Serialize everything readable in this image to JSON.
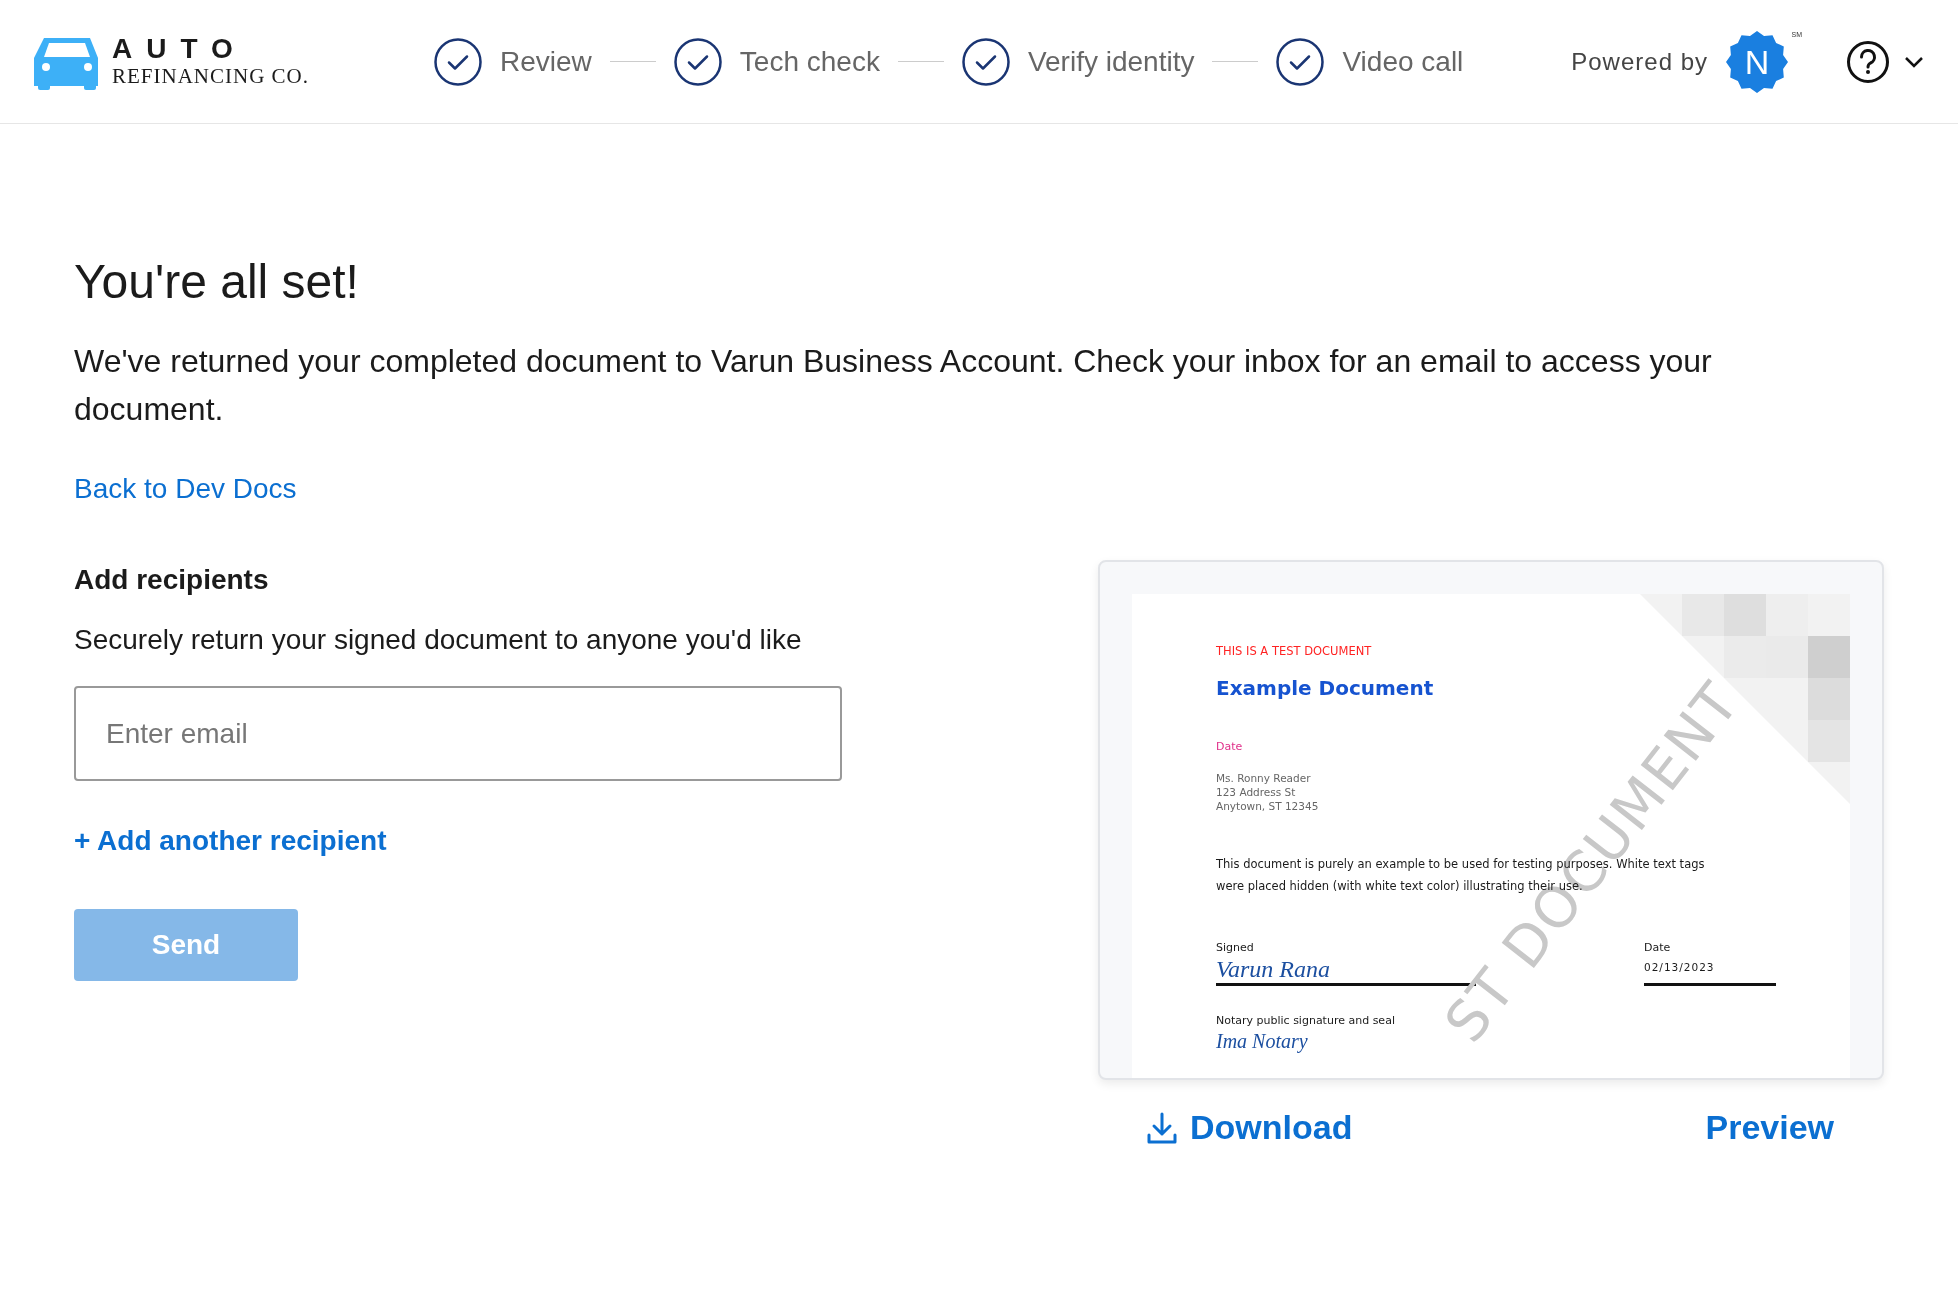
{
  "header": {
    "logo": {
      "line_1": "AUTO",
      "line_2": "REFINANCING CO."
    },
    "steps": [
      {
        "label": "Review",
        "done": true
      },
      {
        "label": "Tech check",
        "done": true
      },
      {
        "label": "Verify identity",
        "done": true
      },
      {
        "label": "Video call",
        "done": true
      }
    ],
    "powered_by": "Powered by",
    "badge_letter": "N",
    "badge_mark": "SM"
  },
  "main": {
    "title": "You're all set!",
    "message": "We've returned your completed document to Varun Business Account. Check your inbox for an email to access your document.",
    "back_link": "Back to Dev Docs",
    "recipients": {
      "heading": "Add recipients",
      "subtitle": "Securely return your signed document to anyone you'd like",
      "email": {
        "placeholder": "Enter email"
      },
      "add_link": "+ Add another recipient",
      "send": {
        "label": "Send",
        "disabled": true
      }
    }
  },
  "document": {
    "test_label": "THIS IS A TEST DOCUMENT",
    "title": "Example Document",
    "date_label": "Date",
    "address": [
      "Ms. Ronny Reader",
      "123 Address St",
      "Anytown, ST 12345"
    ],
    "body": "This document is purely an example to be used for testing purposes. White text tags were placed hidden (with white text color) illustrating their use.",
    "signed_label": "Signed",
    "signature": "Varun Rana",
    "sign_date_label": "Date",
    "sign_date": "02/13/2023",
    "notary_label": "Notary public signature and seal",
    "notary_signature": "Ima Notary",
    "watermark": "ST DOCUMENT"
  },
  "actions": {
    "download": "Download",
    "preview": "Preview"
  }
}
